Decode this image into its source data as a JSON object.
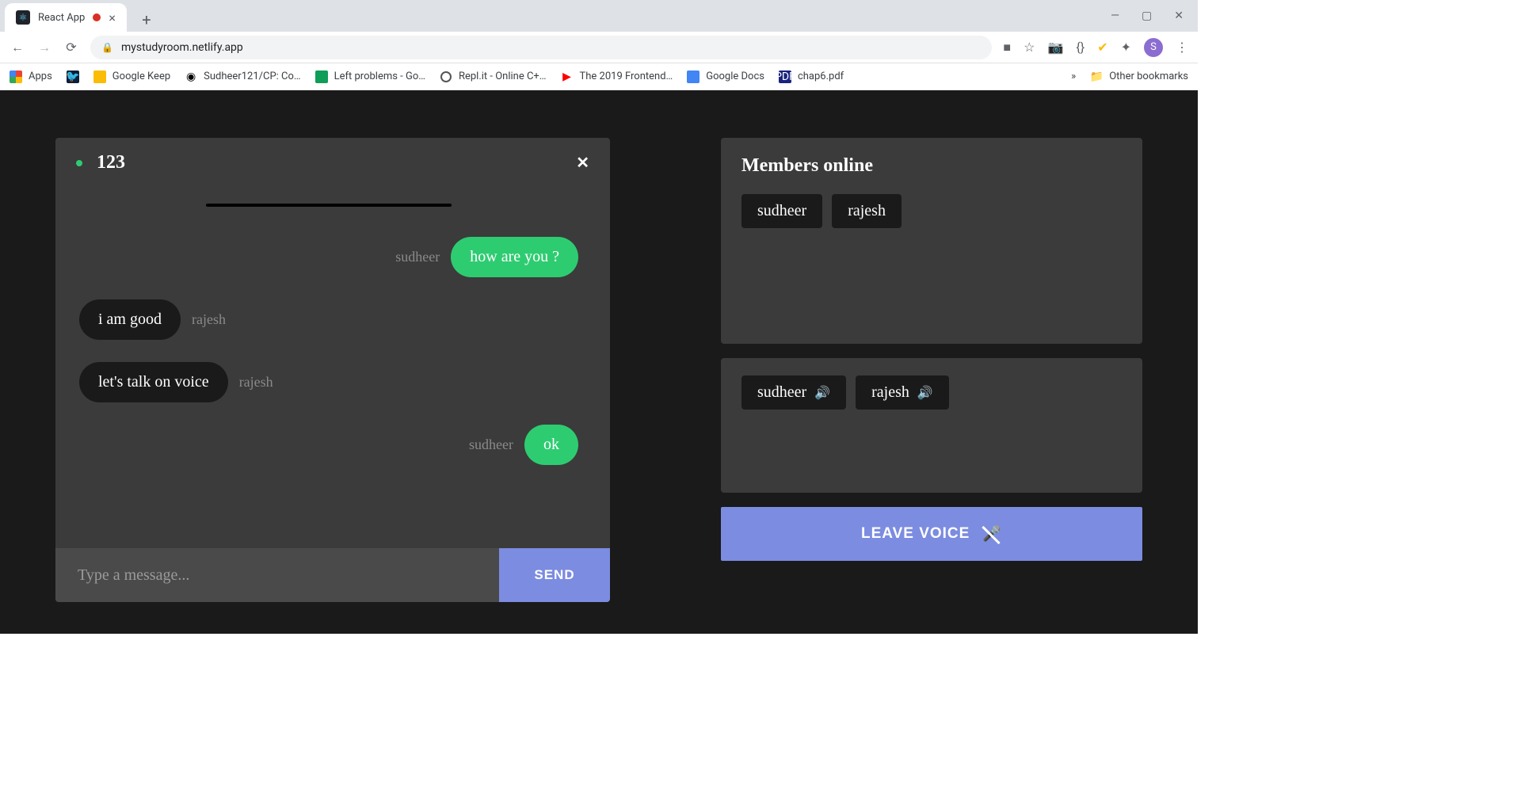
{
  "browser": {
    "tab_title": "React App",
    "url": "mystudyroom.netlify.app",
    "avatar_initial": "S",
    "window_controls": {
      "min": "—",
      "max": "▢",
      "close": "✕"
    },
    "bookmarks": [
      {
        "label": "Apps",
        "icon": "apps"
      },
      {
        "label": "",
        "icon": "bird"
      },
      {
        "label": "Google Keep",
        "icon": "keep"
      },
      {
        "label": "Sudheer121/CP: Co…",
        "icon": "github"
      },
      {
        "label": "Left problems - Go…",
        "icon": "sheets"
      },
      {
        "label": "Repl.it - Online C+…",
        "icon": "replit"
      },
      {
        "label": "The 2019 Frontend…",
        "icon": "youtube"
      },
      {
        "label": "Google Docs",
        "icon": "docs"
      },
      {
        "label": "chap6.pdf",
        "icon": "pdf"
      }
    ],
    "other_bookmarks_label": "Other bookmarks",
    "overflow_glyph": "»"
  },
  "chat": {
    "room_name": "123",
    "close_glyph": "✕",
    "messages": [
      {
        "from": "sudheer",
        "text": "how are you ?",
        "mine": true
      },
      {
        "from": "rajesh",
        "text": "i am good",
        "mine": false
      },
      {
        "from": "rajesh",
        "text": "let's talk on voice",
        "mine": false
      },
      {
        "from": "sudheer",
        "text": "ok",
        "mine": true
      }
    ],
    "input_placeholder": "Type a message...",
    "send_label": "SEND"
  },
  "members": {
    "title": "Members online",
    "list": [
      "sudheer",
      "rajesh"
    ]
  },
  "voice": {
    "participants": [
      "sudheer",
      "rajesh"
    ],
    "leave_label": "LEAVE VOICE"
  }
}
